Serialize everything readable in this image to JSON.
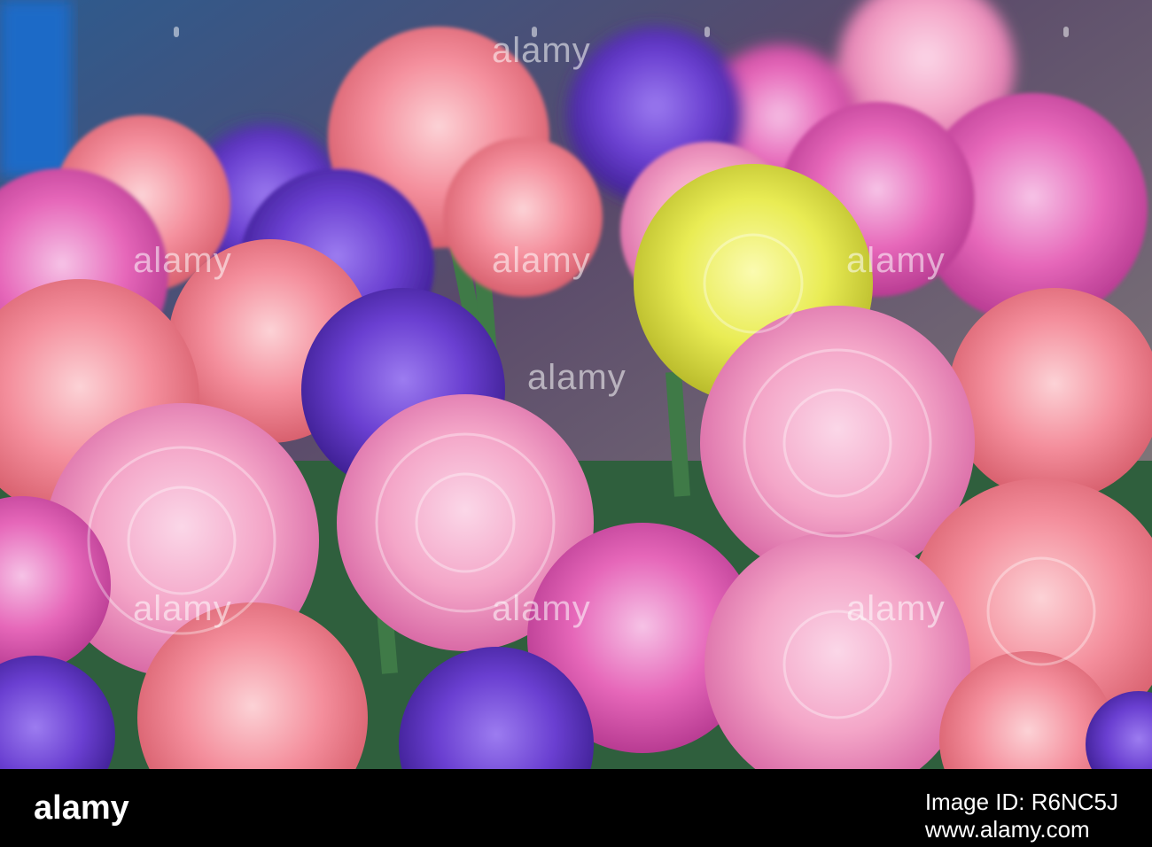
{
  "photo": {
    "subject": "",
    "watermark_text": "alamy",
    "palette": {
      "pink": "#f4a6c8",
      "salmon": "#f48e9c",
      "magenta": "#e667b9",
      "purple": "#6a3fd1",
      "yellow": "#e9ec54",
      "stem": "#3f7a47",
      "background": "#2e4a3a"
    }
  },
  "footer": {
    "logo_text": "alamy",
    "image_id_line": "Image ID: R6NC5J",
    "url_line": "www.alamy.com"
  }
}
